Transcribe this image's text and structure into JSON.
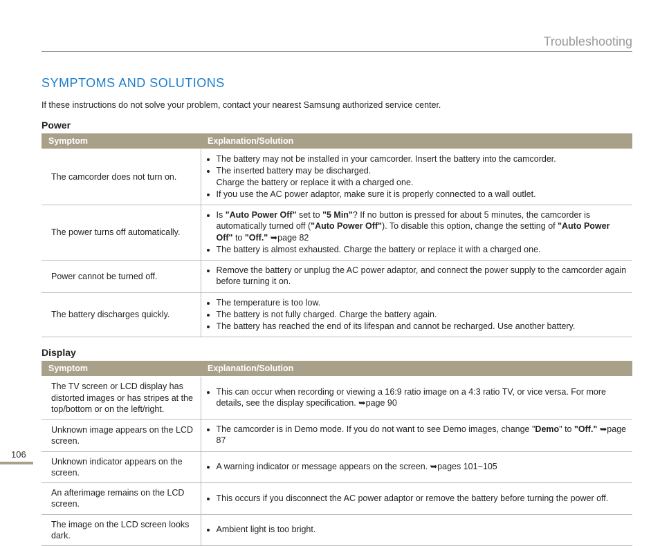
{
  "pageNumber": "106",
  "chapter": "Troubleshooting",
  "sectionTitle": "SYMPTOMS AND SOLUTIONS",
  "intro": "If these instructions do not solve your problem, contact your nearest Samsung authorized service center.",
  "columns": {
    "symptom": "Symptom",
    "explanation": "Explanation/Solution"
  },
  "tables": {
    "power": {
      "heading": "Power",
      "rows": [
        {
          "symptom": "The camcorder does not turn on.",
          "bullets": [
            "The battery may not be installed in your camcorder. Insert the battery into the camcorder.",
            "The inserted battery may be discharged.\nCharge the battery or replace it with a charged one.",
            "If you use the AC power adaptor, make sure it is properly connected to a wall outlet."
          ]
        },
        {
          "symptom": "The power turns off automatically.",
          "bullets": [
            "Is <b>\"Auto Power Off\"</b> set to <b>\"5 Min\"</b>? If no button is pressed for about 5 minutes, the camcorder is automatically turned off (<b>\"Auto Power Off\"</b>). To disable this option, change the setting of <b>\"Auto Power Off\"</b> to <b>\"Off.\"</b> ➥page 82",
            "The battery is almost exhausted. Charge the battery or replace it with a charged one."
          ]
        },
        {
          "symptom": "Power cannot be turned off.",
          "bullets": [
            "Remove the battery or unplug the AC power adaptor, and connect the power supply to the camcorder again before turning it on."
          ]
        },
        {
          "symptom": "The battery discharges quickly.",
          "bullets": [
            "The temperature is too low.",
            "The battery is not fully charged. Charge the battery again.",
            "The battery has reached the end of its lifespan and cannot be recharged. Use another battery."
          ]
        }
      ]
    },
    "display": {
      "heading": "Display",
      "rows": [
        {
          "symptom": "The TV screen or LCD display has distorted images or has stripes at the top/bottom or on the left/right.",
          "bullets": [
            "This can occur when recording or viewing a 16:9 ratio image on a 4:3 ratio TV, or vice versa. For more details, see the display specification. ➥page 90"
          ]
        },
        {
          "symptom": "Unknown image appears on the LCD screen.",
          "bullets": [
            "The camcorder is in Demo mode. If you do not want to see Demo images, change \"<b>Demo</b>\" to <b>\"Off.\"</b> ➥page 87"
          ]
        },
        {
          "symptom": "Unknown indicator appears on the screen.",
          "bullets": [
            "A warning indicator or message appears on the screen. ➥pages 101~105"
          ]
        },
        {
          "symptom": "An afterimage remains on the LCD screen.",
          "bullets": [
            "This occurs if you disconnect the AC power adaptor or remove the battery before turning the power off."
          ]
        },
        {
          "symptom": "The image on the LCD screen looks dark.",
          "bullets": [
            "Ambient light is too bright."
          ]
        }
      ]
    }
  }
}
